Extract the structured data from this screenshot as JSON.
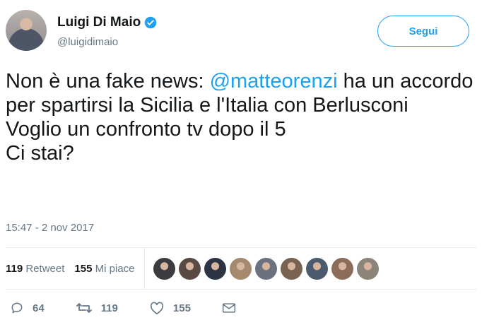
{
  "user": {
    "display_name": "Luigi Di Maio",
    "handle": "@luigidimaio",
    "verified_icon": "verified-badge-icon"
  },
  "follow_button": {
    "label": "Segui"
  },
  "tweet": {
    "before_mention": "Non è una fake news: ",
    "mention": "@matteorenzi",
    "after_mention": " ha un accordo per spartirsi la Sicilia e l'Italia con Berlusconi",
    "line2": "Voglio un confronto tv dopo il 5",
    "line3": "Ci stai?",
    "timestamp": "15:47 - 2 nov 2017"
  },
  "stats": {
    "retweets_count": "119",
    "retweets_label": "Retweet",
    "likes_count": "155",
    "likes_label": "Mi piace"
  },
  "likers": [
    {
      "color": "#3b3b40"
    },
    {
      "color": "#5a4a44"
    },
    {
      "color": "#2c3444"
    },
    {
      "color": "#a58a70"
    },
    {
      "color": "#6c7180"
    },
    {
      "color": "#7a6251"
    },
    {
      "color": "#4b5b6d"
    },
    {
      "color": "#8a6c58"
    },
    {
      "color": "#8d8479"
    }
  ],
  "actions": {
    "reply_count": "64",
    "retweet_count": "119",
    "like_count": "155"
  },
  "colors": {
    "accent": "#1da1f2",
    "muted": "#657786",
    "text": "#14171a"
  }
}
